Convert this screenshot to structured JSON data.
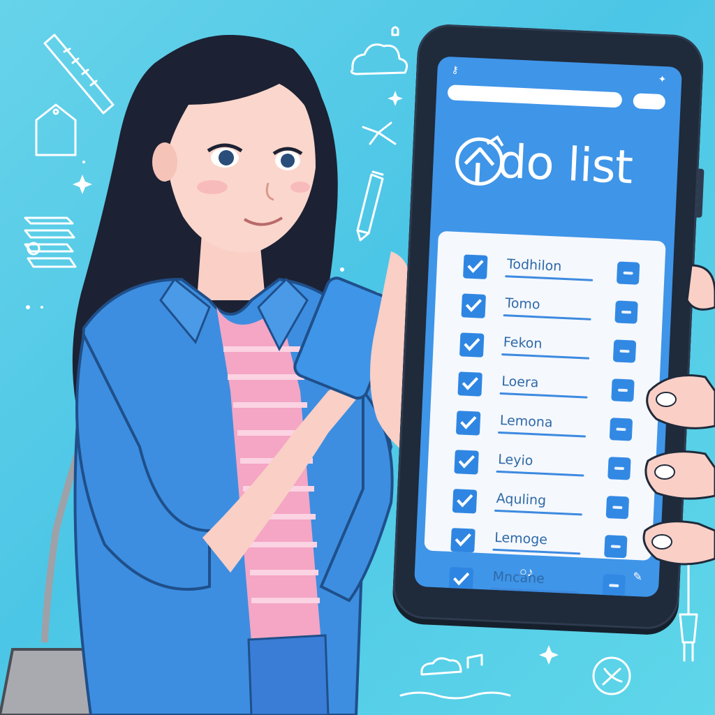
{
  "app": {
    "title": "do list",
    "logo_icon": "check-house-logo-icon"
  },
  "status_bar": {
    "left_icon": "key-icon",
    "right_icon": "sparkle-icon"
  },
  "search": {
    "placeholder": ""
  },
  "tasks": [
    {
      "label": "Todhilon",
      "checked": true
    },
    {
      "label": "Tomo",
      "checked": true
    },
    {
      "label": "Fekon",
      "checked": true
    },
    {
      "label": "Loera",
      "checked": true
    },
    {
      "label": "Lemona",
      "checked": true
    },
    {
      "label": "Leyio",
      "checked": true
    },
    {
      "label": "Aquling",
      "checked": true
    },
    {
      "label": "Lemoge",
      "checked": true
    },
    {
      "label": "Mncahe",
      "checked": true
    }
  ],
  "bottom_bar": {
    "left_icon": "search-music-icon",
    "right_icon": "edit-icon"
  },
  "colors": {
    "background": "#58cde8",
    "screen": "#3f95e8",
    "card": "#f5f8fd",
    "accent": "#2f86e2",
    "jacket": "#3d8ee0",
    "shirt_pink": "#f4a6c4",
    "hair": "#1c2233"
  }
}
